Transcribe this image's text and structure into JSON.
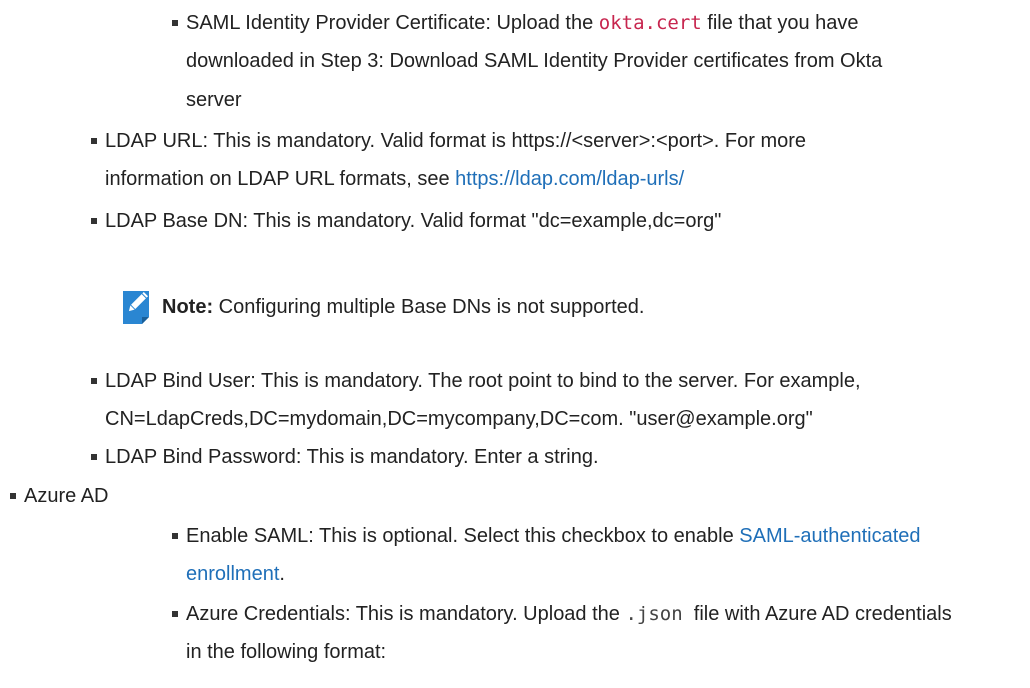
{
  "items": {
    "saml_cert": {
      "label": "SAML Identity Provider Certificate: Upload the ",
      "code": "okta.cert",
      "rest1": " file that you have",
      "line2": "downloaded in Step 3: Download SAML Identity Provider certificates from Okta",
      "line3": "server"
    },
    "ldap_url": {
      "line1": "LDAP URL: This is mandatory. Valid format is https://<server>:<port>. For more",
      "line2_text": "information on LDAP URL formats, see ",
      "line2_link": "https://ldap.com/ldap-urls/"
    },
    "ldap_base_dn": {
      "line1": "LDAP Base DN: This is mandatory. Valid format \"dc=example,dc=org\""
    },
    "note": {
      "label": "Note:",
      "text": " Configuring multiple Base DNs is not supported."
    },
    "ldap_bind_user": {
      "line1": "LDAP Bind User: This is mandatory. The root point to bind to the server. For example,",
      "line2": "CN=LdapCreds,DC=mydomain,DC=mycompany,DC=com. \"user@example.org\""
    },
    "ldap_bind_password": {
      "line1": "LDAP Bind Password: This is mandatory. Enter a string."
    },
    "azure_ad": {
      "label": "Azure AD"
    },
    "enable_saml": {
      "line1_text": "Enable SAML: This is optional. Select this checkbox to enable ",
      "line1_link": "SAML-authenticated",
      "line2_link": "enrollment",
      "line2_text": "."
    },
    "azure_credentials": {
      "line1_text": "Azure Credentials: This is mandatory. Upload the ",
      "line1_code": ".json",
      "line1_rest": "  file with Azure AD credentials",
      "line2": "in the following format:"
    }
  },
  "colors": {
    "link": "#1f6fb8",
    "code": "#c7254e",
    "note_icon": "#2a86d2"
  }
}
